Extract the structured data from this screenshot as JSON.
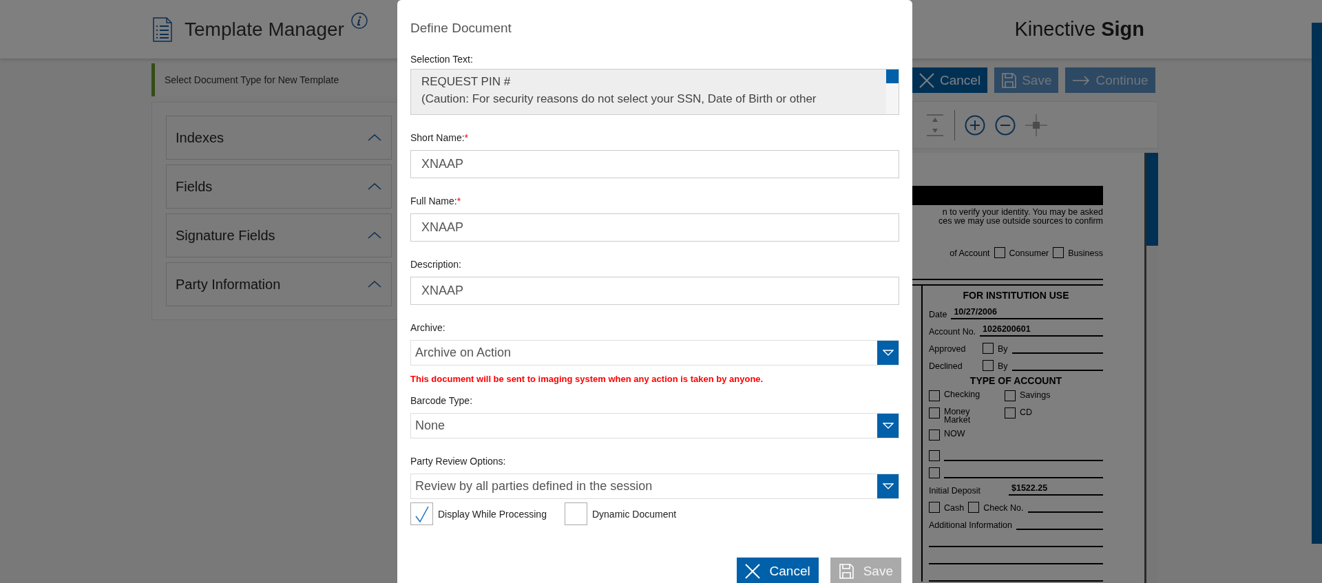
{
  "header": {
    "title": "Template Manager",
    "brand": "Kinective **Sign**"
  },
  "left_panel": {
    "banner": "Select Document Type for New Template",
    "sections": [
      {
        "label": "Indexes"
      },
      {
        "label": "Fields"
      },
      {
        "label": "Signature Fields"
      },
      {
        "label": "Party Information"
      }
    ]
  },
  "action_buttons": [
    {
      "label": "Cancel",
      "kind": "cancel"
    },
    {
      "label": "Save",
      "kind": "save"
    },
    {
      "label": "Continue",
      "kind": "continue"
    }
  ],
  "document": {
    "intro_lines": [
      "n to verify your identity. You may be asked",
      "ces we may use outside sources to confirm"
    ],
    "account_type": {
      "label": "of Account",
      "options": [
        {
          "label": "Consumer",
          "checked": false
        },
        {
          "label": "Business",
          "checked": false
        }
      ]
    },
    "institution": {
      "heading": "FOR INSTITUTION USE",
      "entries": [
        {
          "label": "Date",
          "value": "10/27/2006"
        },
        {
          "label": "Account No.",
          "value": "1026200601"
        }
      ],
      "approvals": [
        {
          "label": "Approved",
          "checked": false,
          "by": "By"
        },
        {
          "label": "Declined",
          "checked": false,
          "by": "By"
        }
      ],
      "type_heading": "TYPE OF ACCOUNT",
      "account_types": [
        {
          "left": {
            "label": "Checking",
            "checked": false
          },
          "right": {
            "label": "Savings",
            "checked": false
          }
        },
        {
          "left": {
            "label": "Money Market",
            "checked": false
          },
          "right": {
            "label": "CD",
            "checked": false
          }
        },
        {
          "left": {
            "label": "NOW",
            "checked": false
          }
        }
      ],
      "blank_options": [
        {
          "checked": false
        },
        {
          "checked": false
        }
      ],
      "deposit": {
        "label": "Initial Deposit",
        "value": "$1522.25"
      },
      "payment": [
        {
          "label": "Cash",
          "checked": false
        },
        {
          "label": "Check No.",
          "checked": false
        }
      ],
      "additional": "Additional Information"
    }
  },
  "modal": {
    "title": "Define Document",
    "selection_text": {
      "label": "Selection Text:",
      "lines": [
        "REQUEST PIN #",
        "(Caution: For security reasons do not select your SSN, Date of Birth or other"
      ]
    },
    "fields": [
      {
        "label": "Short Name:",
        "required_mark": "*",
        "value": "XNAAP"
      },
      {
        "label": "Full Name:",
        "required_mark": "*",
        "value": "XNAAP"
      },
      {
        "label": "Description:",
        "value": "XNAAP"
      }
    ],
    "archive": {
      "label": "Archive:",
      "value": "Archive on Action",
      "warning": "This document will be sent to imaging system when any action is taken by anyone."
    },
    "barcode": {
      "label": "Barcode Type:",
      "value": "None"
    },
    "party_review": {
      "label": "Party Review Options:",
      "value": "Review by all parties defined in the session"
    },
    "checkboxes": [
      {
        "label": "Display While Processing",
        "checked": true
      },
      {
        "label": "Dynamic Document",
        "checked": false
      }
    ],
    "buttons": [
      {
        "label": "Cancel",
        "kind": "cancel",
        "disabled": false
      },
      {
        "label": "Save",
        "kind": "save",
        "disabled": true
      }
    ]
  }
}
